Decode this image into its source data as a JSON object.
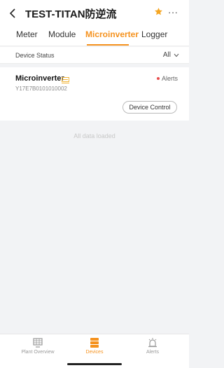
{
  "header": {
    "title": "TEST-TITAN防逆流",
    "more": "···"
  },
  "tabs": [
    {
      "label": "Meter"
    },
    {
      "label": "Module"
    },
    {
      "label": "Microinverter"
    },
    {
      "label": "Logger"
    }
  ],
  "active_tab": "Microinverter",
  "filter": {
    "label": "Device Status",
    "value": "All"
  },
  "device": {
    "name": "Microinverter",
    "serial": "Y17E7B0101010002",
    "alert_label": "Alerts",
    "control_button": "Device Control"
  },
  "list_status": "All data loaded",
  "bottom_nav": [
    {
      "label": "Plant Overview",
      "icon": "plant-overview-icon"
    },
    {
      "label": "Devices",
      "icon": "devices-icon"
    },
    {
      "label": "Alerts",
      "icon": "alerts-icon"
    }
  ],
  "colors": {
    "accent": "#f5921e",
    "alert": "#e84d4d",
    "background": "#f2f3f5"
  }
}
